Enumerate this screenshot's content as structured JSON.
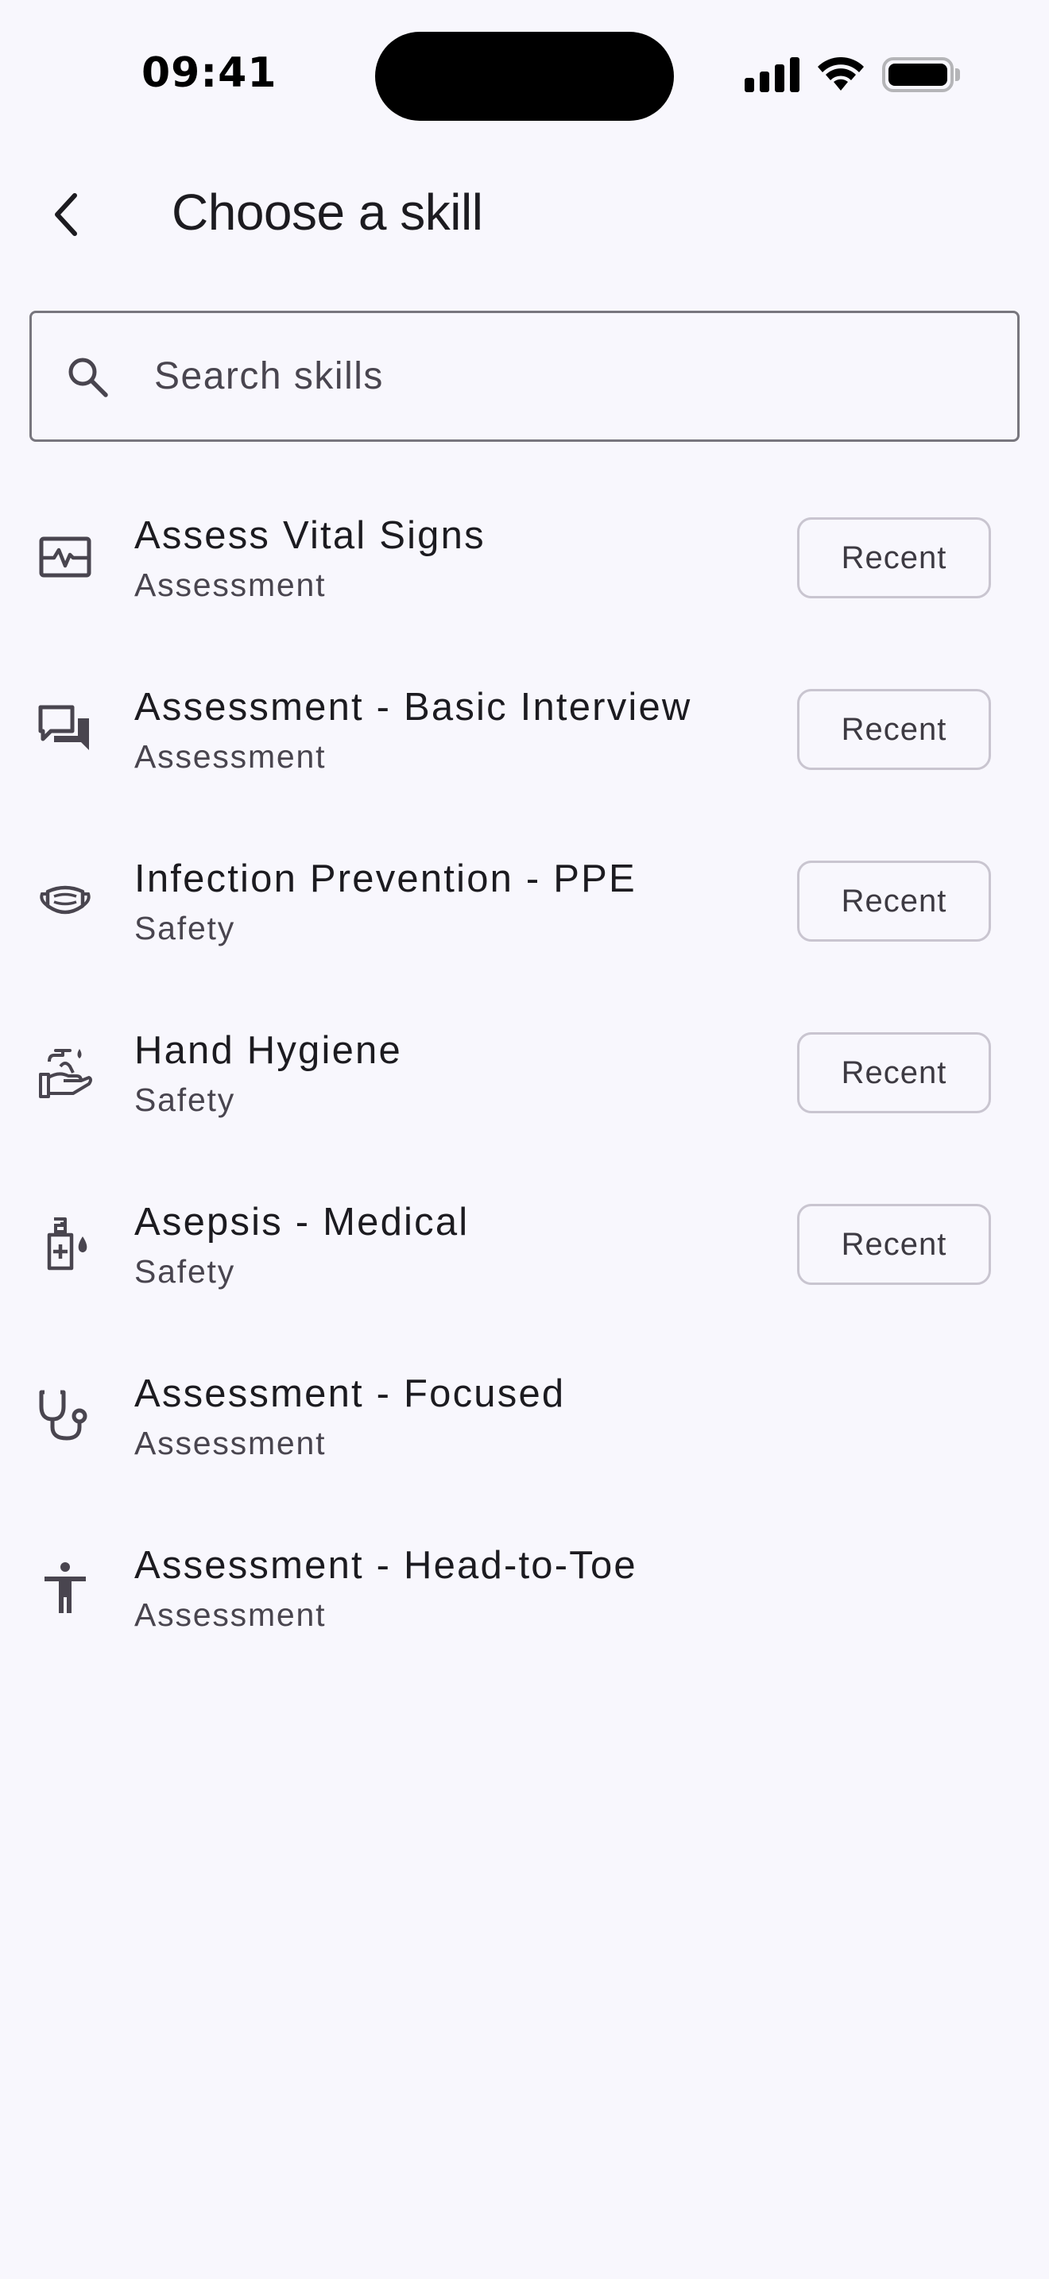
{
  "status_bar": {
    "time": "09:41"
  },
  "header": {
    "title": "Choose a skill",
    "back_icon": "chevron-left-icon"
  },
  "search": {
    "placeholder": "Search skills",
    "value": "",
    "icon": "search-icon"
  },
  "skills": [
    {
      "name": "Assess Vital Signs",
      "category": "Assessment",
      "icon": "vital-signs-monitor-icon",
      "recent_label": "Recent"
    },
    {
      "name": "Assessment - Basic Interview",
      "category": "Assessment",
      "icon": "chat-bubbles-icon",
      "recent_label": "Recent"
    },
    {
      "name": "Infection Prevention - PPE",
      "category": "Safety",
      "icon": "face-mask-icon",
      "recent_label": "Recent"
    },
    {
      "name": "Hand Hygiene",
      "category": "Safety",
      "icon": "hand-wash-icon",
      "recent_label": "Recent"
    },
    {
      "name": "Asepsis - Medical",
      "category": "Safety",
      "icon": "sanitizer-icon",
      "recent_label": "Recent"
    },
    {
      "name": "Assessment - Focused",
      "category": "Assessment",
      "icon": "stethoscope-icon",
      "recent_label": null
    },
    {
      "name": "Assessment - Head-to-Toe",
      "category": "Assessment",
      "icon": "accessibility-person-icon",
      "recent_label": null
    }
  ],
  "colors": {
    "background": "#f8f7fd",
    "text_primary": "#1c1b20",
    "text_secondary": "#49454f",
    "outline": "#78767e",
    "chip_outline": "#c9c5d0"
  }
}
